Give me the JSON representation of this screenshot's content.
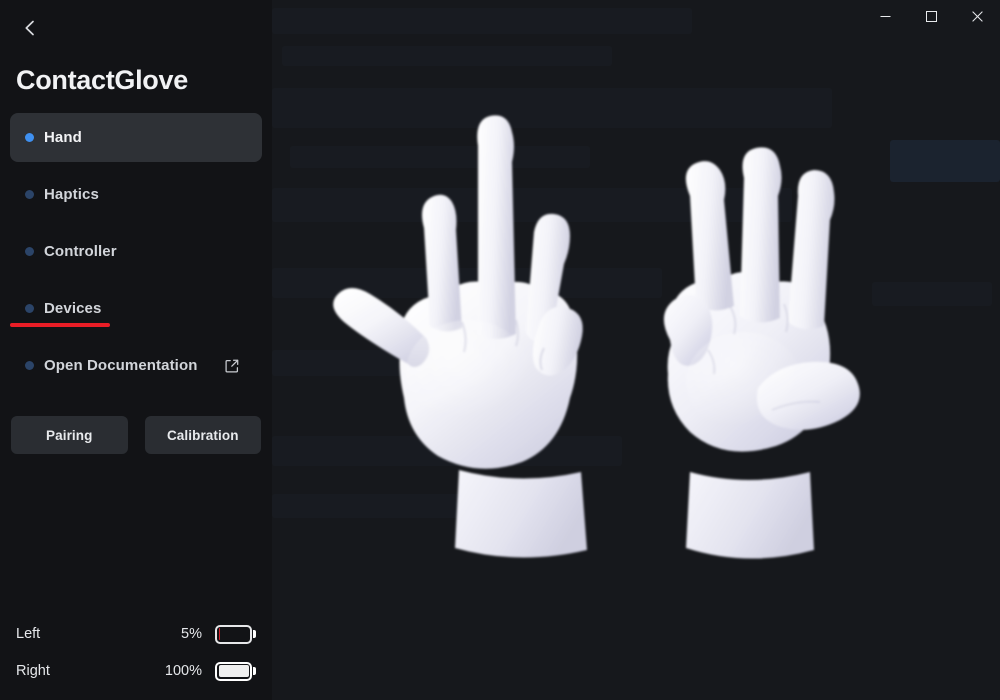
{
  "window": {
    "controls": [
      {
        "name": "minimize",
        "glyph": "minimize-icon",
        "label": "Minimize"
      },
      {
        "name": "maximize",
        "glyph": "maximize-icon",
        "label": "Maximize"
      },
      {
        "name": "close",
        "glyph": "close-icon",
        "label": "Close"
      }
    ]
  },
  "sidebar": {
    "back_label": "Back",
    "back_icon": "chevron-left-icon",
    "title": "ContactGlove",
    "items": [
      {
        "label": "Hand",
        "active": true,
        "icon": "status-dot"
      },
      {
        "label": "Haptics",
        "active": false,
        "icon": "status-dot"
      },
      {
        "label": "Controller",
        "active": false,
        "icon": "status-dot"
      },
      {
        "label": "Devices",
        "active": false,
        "icon": "status-dot",
        "underline": true
      },
      {
        "label": "Open Documentation",
        "active": false,
        "icon": "status-dot",
        "external": true,
        "external_icon": "external-link-icon"
      }
    ],
    "buttons": [
      {
        "label": "Pairing"
      },
      {
        "label": "Calibration"
      }
    ],
    "batteries": [
      {
        "name": "Left",
        "percent_label": "5%",
        "percent": 5,
        "state": "low"
      },
      {
        "name": "Right",
        "percent_label": "100%",
        "percent": 100,
        "state": "full"
      }
    ]
  },
  "main": {
    "scene_name": "hand-tracking-3d-viewport",
    "hands": [
      {
        "side": "left",
        "pose": "thumb-and-two-fingers-extended"
      },
      {
        "side": "right",
        "pose": "three-fingers-extended-thumb-across-palm"
      }
    ]
  },
  "colors": {
    "accent_blue": "#3f90f0",
    "inactive_dot": "#2b4468",
    "underline_red": "#e91d26",
    "battery_low": "#d32029",
    "battery_full": "#f0f0f0",
    "sidebar_bg": "#121316",
    "main_bg": "#16181c",
    "active_item_bg": "#2e3136",
    "button_bg": "#2a2d32",
    "hand_material": "#e9e9f2"
  }
}
